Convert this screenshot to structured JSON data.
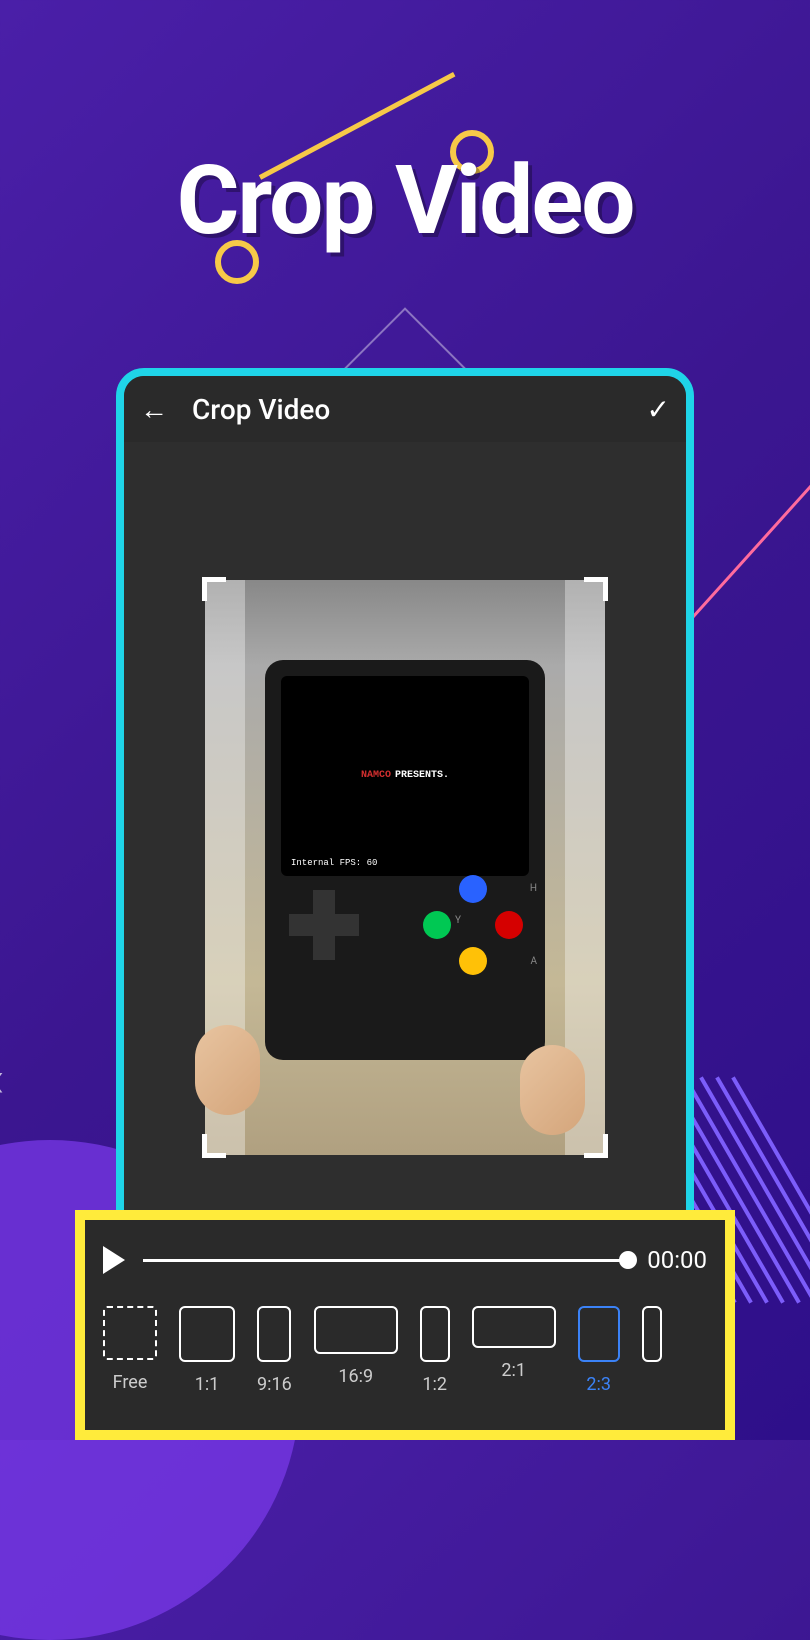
{
  "page": {
    "title": "Crop Video"
  },
  "app": {
    "header": {
      "title": "Crop Video"
    },
    "preview": {
      "console_brand": "NAMCO",
      "console_presents": "PRESENTS.",
      "console_fps": "Internal FPS: 60"
    },
    "playback": {
      "time": "00:00"
    },
    "ratios": [
      {
        "label": "Free",
        "shape": "free",
        "active": false
      },
      {
        "label": "1:1",
        "shape": "1-1",
        "active": false
      },
      {
        "label": "9:16",
        "shape": "9-16",
        "active": false
      },
      {
        "label": "16:9",
        "shape": "16-9",
        "active": false
      },
      {
        "label": "1:2",
        "shape": "1-2",
        "active": false
      },
      {
        "label": "2:1",
        "shape": "2-1",
        "active": false
      },
      {
        "label": "2:3",
        "shape": "2-3",
        "active": true
      }
    ]
  }
}
